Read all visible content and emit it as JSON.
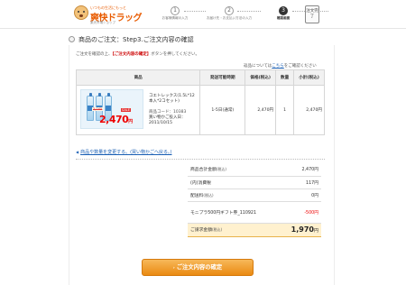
{
  "header": {
    "logo_tagline": "いつもの生活にもっと",
    "logo_name": "爽快ドラッグ",
    "logo_sub": "楽天市場ショップ",
    "steps": [
      {
        "num": "1",
        "label": "お客様情報の入力",
        "active": false
      },
      {
        "num": "2",
        "label": "お届け先・お支払い方法の入力",
        "active": false
      },
      {
        "num": "3",
        "label": "確認画面",
        "active": true
      }
    ],
    "done_label": "注文完了"
  },
  "page": {
    "title": "商品のご注文：Step3.ご注文内容の確認",
    "guide_prefix": "ご注文を確認の上、",
    "guide_strong": "【ご注文内容の確定】",
    "guide_suffix": "ボタンを押してください。",
    "return_prefix": "返品については",
    "return_link": "こちら",
    "return_suffix": "をご確認ください"
  },
  "items_table": {
    "headers": [
      "商品",
      "発送可能時期",
      "価格(税込)",
      "数量",
      "小計(税込)"
    ],
    "rows": [
      {
        "image_price": "2,470",
        "image_price_unit": "円",
        "image_strike": "3,045",
        "image_tag": "SALE",
        "name": "コエトレックス(1.5L*12本入*2コセット)",
        "code_label": "商品コード：10383",
        "date_label": "買い物かご投入日：2011/10/15",
        "ship": "1-5日(通常)",
        "price": "2,470円",
        "qty": "1",
        "subtotal": "2,470円"
      }
    ]
  },
  "change_link": "商品や数量を変更する。(買い物かごへ戻る。)",
  "summary": {
    "rows": [
      {
        "label": "商品合計金額",
        "label_small": "(税込)",
        "amount": "2,470円"
      },
      {
        "label": "(内)消費税",
        "label_small": "",
        "amount": "117円"
      },
      {
        "label": "配送料",
        "label_small": "(税込)",
        "amount": "0円"
      },
      {
        "label": "モニプラ500円ギフト券_110921",
        "label_small": "",
        "amount": "-500円"
      }
    ],
    "total_label": "ご請求金額",
    "total_small": "(税込)",
    "total_amount": "1,970",
    "total_unit": "円"
  },
  "confirm_button": "ご注文内容の確定"
}
